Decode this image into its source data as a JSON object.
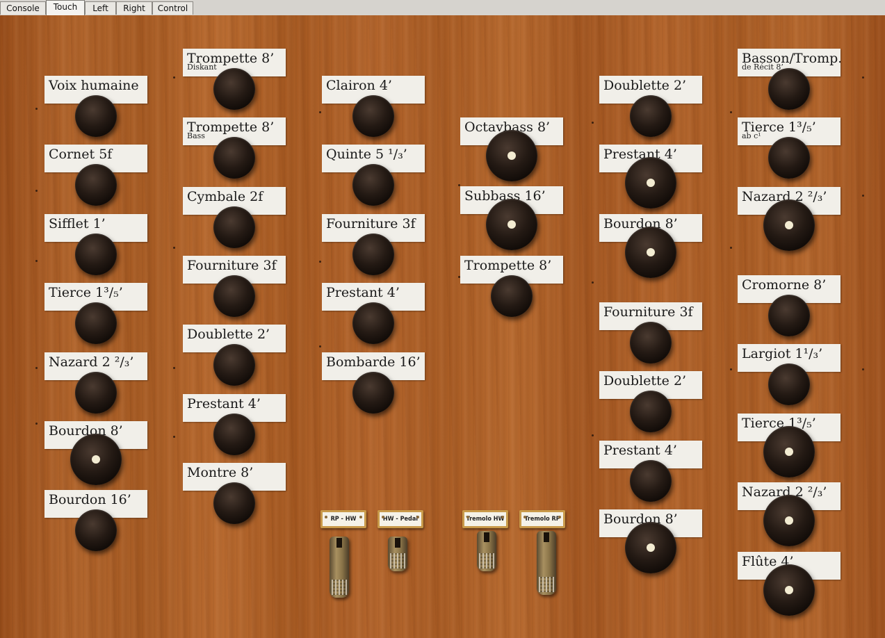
{
  "tabs": [
    "Console",
    "Touch",
    "Left",
    "Right",
    "Control"
  ],
  "active_tab": "Touch",
  "columns": [
    {
      "name": "col1",
      "stops": [
        {
          "label": "Voix humaine",
          "sub": "",
          "on": false
        },
        {
          "label": "Cornet 5f",
          "sub": "",
          "on": false
        },
        {
          "label": "Sifflet 1’",
          "sub": "",
          "on": false
        },
        {
          "label": "Tierce 1³/₅’",
          "sub": "",
          "on": false
        },
        {
          "label": "Nazard 2 ²/₃’",
          "sub": "",
          "on": false
        },
        {
          "label": "Bourdon 8’",
          "sub": "",
          "on": true
        },
        {
          "label": "Bourdon 16’",
          "sub": "",
          "on": false
        }
      ]
    },
    {
      "name": "col2",
      "stops": [
        {
          "label": "Trompette 8’",
          "sub": "Diskant",
          "on": false
        },
        {
          "label": "Trompette 8’",
          "sub": "Bass",
          "on": false
        },
        {
          "label": "Cymbale 2f",
          "sub": "",
          "on": false
        },
        {
          "label": "Fourniture 3f",
          "sub": "",
          "on": false
        },
        {
          "label": "Doublette 2’",
          "sub": "",
          "on": false
        },
        {
          "label": "Prestant 4’",
          "sub": "",
          "on": false
        },
        {
          "label": "Montre 8’",
          "sub": "",
          "on": false
        }
      ]
    },
    {
      "name": "col3",
      "stops": [
        {
          "label": "Clairon 4’",
          "sub": "",
          "on": false
        },
        {
          "label": "Quinte 5 ¹/₃’",
          "sub": "",
          "on": false
        },
        {
          "label": "Fourniture 3f",
          "sub": "",
          "on": false
        },
        {
          "label": "Prestant 4’",
          "sub": "",
          "on": false
        },
        {
          "label": "Bombarde 16’",
          "sub": "",
          "on": false
        }
      ]
    },
    {
      "name": "col4",
      "stops": [
        {
          "label": "Octavbass 8’",
          "sub": "",
          "on": true
        },
        {
          "label": "Subbass 16’",
          "sub": "",
          "on": true
        },
        {
          "label": "Trompette 8’",
          "sub": "",
          "on": false
        }
      ]
    },
    {
      "name": "col5",
      "stops": [
        {
          "label": "Doublette 2’",
          "sub": "",
          "on": false
        },
        {
          "label": "Prestant 4’",
          "sub": "",
          "on": true
        },
        {
          "label": "Bourdon 8’",
          "sub": "",
          "on": true
        },
        {
          "label": "Fourniture 3f",
          "sub": "",
          "on": false
        },
        {
          "label": "Doublette 2’",
          "sub": "",
          "on": false
        },
        {
          "label": "Prestant 4’",
          "sub": "",
          "on": false
        },
        {
          "label": "Bourdon 8’",
          "sub": "",
          "on": true
        }
      ]
    },
    {
      "name": "col6",
      "stops": [
        {
          "label": "Basson/Tromp.",
          "sub": "de Récit 8’",
          "on": false
        },
        {
          "label": "Tierce 1³/₅’",
          "sub": "ab c¹",
          "on": false
        },
        {
          "label": "Nazard 2 ²/₃’",
          "sub": "",
          "on": true
        },
        {
          "label": "Cromorne 8’",
          "sub": "",
          "on": false
        },
        {
          "label": "Largiot 1¹/₃’",
          "sub": "",
          "on": false
        },
        {
          "label": "Tierce 1³/₅’",
          "sub": "",
          "on": true
        },
        {
          "label": "Nazard 2 ²/₃’",
          "sub": "",
          "on": true
        },
        {
          "label": "Flûte 4’",
          "sub": "",
          "on": true
        }
      ]
    }
  ],
  "couplers": [
    {
      "label": "RP - HW"
    },
    {
      "label": "HW - Pedal"
    },
    {
      "label": "Tremolo HW"
    },
    {
      "label": "Tremolo RP"
    }
  ],
  "pedals": [
    {
      "name": "coupler-pedal-rp-hw",
      "state": "down"
    },
    {
      "name": "coupler-pedal-hw-pedal",
      "state": "up"
    },
    {
      "name": "tremolo-pedal-hw",
      "state": "up"
    },
    {
      "name": "tremolo-pedal-rp",
      "state": "down"
    }
  ]
}
